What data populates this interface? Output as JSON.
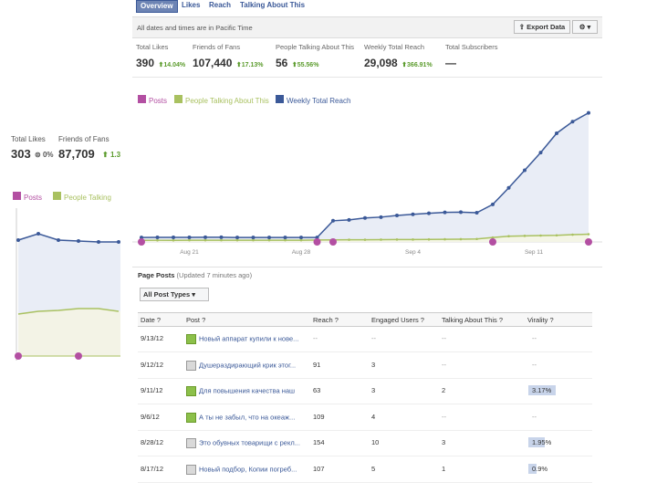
{
  "tabs": [
    "Overview",
    "Likes",
    "Reach",
    "Talking About This"
  ],
  "info_text": "All dates and times are in Pacific Time",
  "export_label": "Export Data",
  "gear_caret": "⚙ ▾",
  "stats": [
    {
      "label": "Total Likes",
      "value": "390",
      "change": "14.04%"
    },
    {
      "label": "Friends of Fans",
      "value": "107,440",
      "change": "17.13%"
    },
    {
      "label": "People Talking About This",
      "value": "56",
      "change": "55.56%"
    },
    {
      "label": "Weekly Total Reach",
      "value": "29,098",
      "change": "366.91%"
    },
    {
      "label": "Total Subscribers",
      "value": "—",
      "change": ""
    }
  ],
  "legend": [
    "Posts",
    "People Talking About This",
    "Weekly Total Reach"
  ],
  "x_ticks": [
    "Aug 21",
    "Aug 28",
    "Sep 4",
    "Sep 11"
  ],
  "colors": {
    "reach": "#3b5998",
    "talking": "#a9c160",
    "posts": "#b34fa2",
    "tab_blue": "#3b5998",
    "green_up": "#5b9b2c"
  },
  "chart_data": {
    "type": "line",
    "series": [
      {
        "name": "Weekly Total Reach",
        "values": [
          4.0,
          4.1,
          4.1,
          4.1,
          4.2,
          4.2,
          4.0,
          4.0,
          4.0,
          4.0,
          4.0,
          4.0,
          19.2,
          20.0,
          21.7,
          22.5,
          24.0,
          25.0,
          26.0,
          26.8,
          27.0,
          26.5,
          34.0,
          49.0,
          65.0,
          81.0,
          98.5,
          109.0,
          117.0
        ]
      },
      {
        "name": "People Talking About This",
        "values": [
          1.4,
          1.5,
          1.5,
          1.6,
          1.6,
          1.6,
          1.6,
          1.6,
          1.6,
          1.6,
          1.6,
          1.8,
          1.9,
          2.0,
          2.0,
          2.1,
          2.2,
          2.2,
          2.3,
          2.4,
          2.5,
          2.7,
          4.0,
          5.2,
          5.5,
          5.8,
          6.0,
          6.6,
          7.0
        ]
      },
      {
        "name": "Posts",
        "points": [
          0,
          11,
          12,
          22,
          28
        ]
      }
    ]
  },
  "left": {
    "labels": [
      "Total Likes",
      "Friends of Fans"
    ],
    "values": [
      "303",
      "87,709"
    ],
    "changes": [
      "0%",
      "1.3"
    ],
    "legend": [
      "Posts",
      "People Talking"
    ]
  },
  "page_posts": {
    "title": "Page Posts",
    "updated": "(Updated 7 minutes ago)",
    "filter": "All Post Types ▾",
    "headers": [
      "Date ?",
      "Post ?",
      "Reach ?",
      "Engaged Users ?",
      "Talking About This ?",
      "Virality ?"
    ],
    "rows": [
      {
        "date": "9/13/12",
        "post": "Новый аппарат купили к нове...",
        "reach": "--",
        "engaged": "--",
        "talking": "--",
        "virality": "--",
        "vir_val": 0,
        "icon": "status"
      },
      {
        "date": "9/12/12",
        "post": "Душераздирающий крик этог...",
        "reach": "91",
        "engaged": "3",
        "talking": "--",
        "virality": "--",
        "vir_val": 0,
        "icon": "photo"
      },
      {
        "date": "9/11/12",
        "post": "Для повышения качества наш",
        "reach": "63",
        "engaged": "3",
        "talking": "2",
        "virality": "3.17%",
        "vir_val": 3.17,
        "icon": "status"
      },
      {
        "date": "9/6/12",
        "post": "А ты не забыл, что на океаж...",
        "reach": "109",
        "engaged": "4",
        "talking": "--",
        "virality": "--",
        "vir_val": 0,
        "icon": "status"
      },
      {
        "date": "8/28/12",
        "post": "Это обувных товарищи с рекл...",
        "reach": "154",
        "engaged": "10",
        "talking": "3",
        "virality": "1.95%",
        "vir_val": 1.95,
        "icon": "photo"
      },
      {
        "date": "8/17/12",
        "post": "Новый подбор, Копии погреб...",
        "reach": "107",
        "engaged": "5",
        "talking": "1",
        "virality": "0.9%",
        "vir_val": 0.9,
        "icon": "photo"
      }
    ]
  }
}
